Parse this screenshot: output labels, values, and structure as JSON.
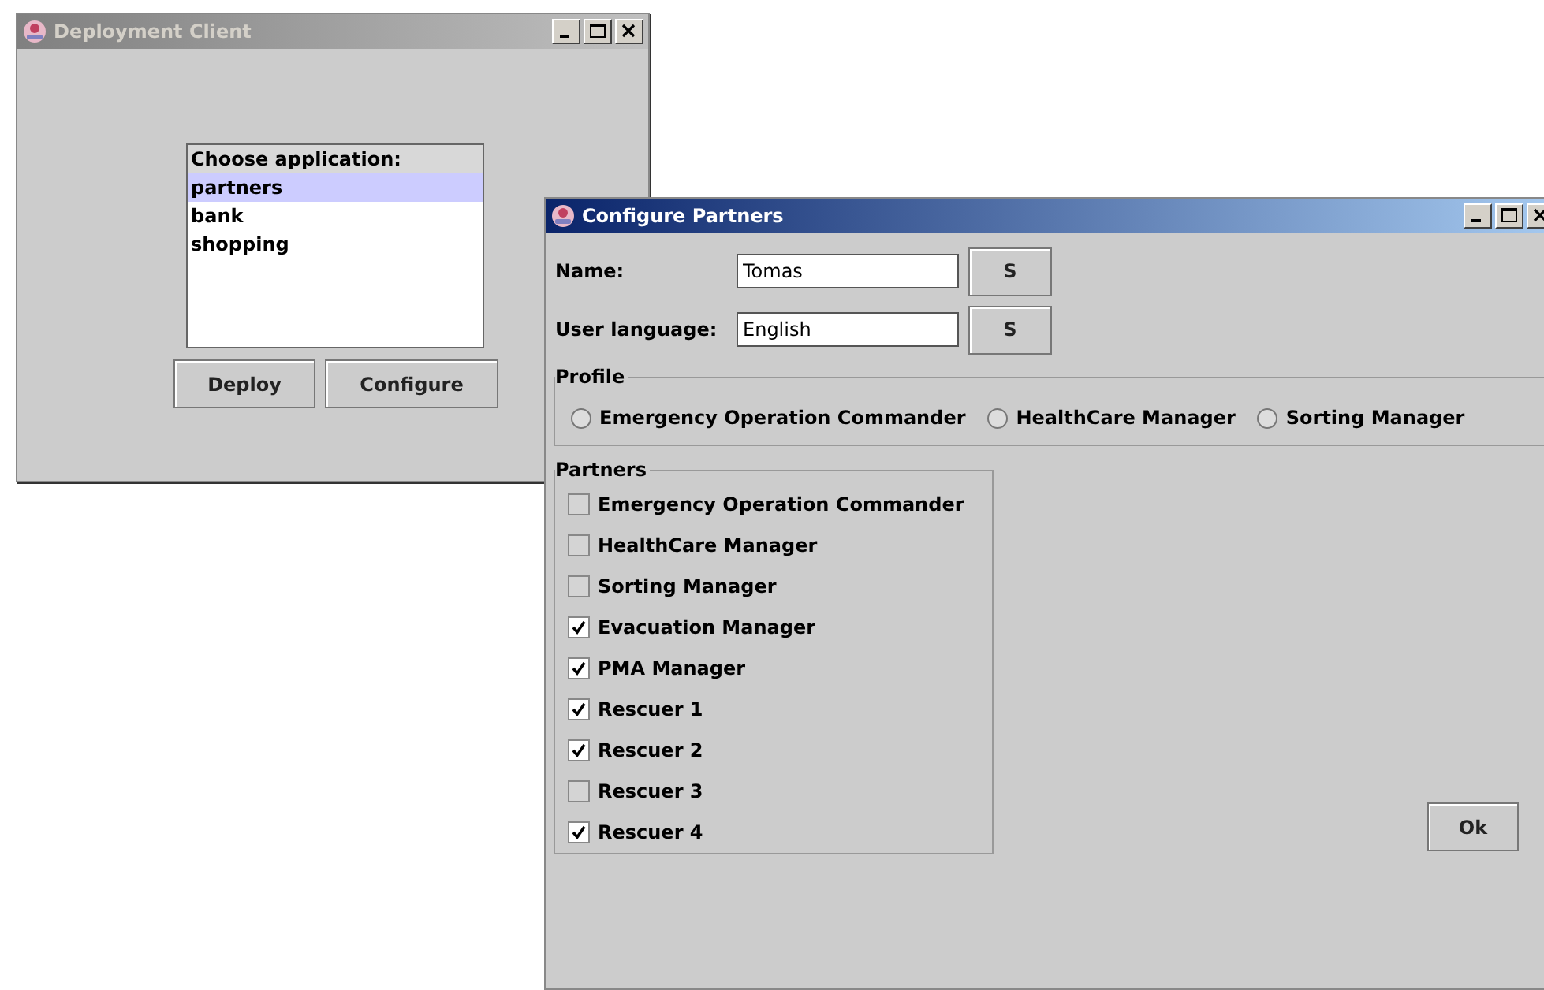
{
  "deployment_window": {
    "title": "Deployment Client",
    "active": false,
    "list": {
      "header": "Choose application:",
      "items": [
        {
          "label": "partners",
          "selected": true
        },
        {
          "label": "bank",
          "selected": false
        },
        {
          "label": "shopping",
          "selected": false
        }
      ]
    },
    "buttons": [
      "Deploy",
      "Configure"
    ]
  },
  "configure_window": {
    "title": "Configure Partners",
    "active": true,
    "fields": [
      {
        "label": "Name:",
        "value": "Tomas",
        "button": "S"
      },
      {
        "label": "User language:",
        "value": "English",
        "button": "S"
      }
    ],
    "profile": {
      "title": "Profile",
      "options": [
        {
          "label": "Emergency Operation Commander",
          "selected": false
        },
        {
          "label": "HealthCare Manager",
          "selected": false
        },
        {
          "label": "Sorting Manager",
          "selected": false
        }
      ]
    },
    "partners": {
      "title": "Partners",
      "items": [
        {
          "label": "Emergency Operation Commander",
          "checked": false
        },
        {
          "label": "HealthCare Manager",
          "checked": false
        },
        {
          "label": "Sorting Manager",
          "checked": false
        },
        {
          "label": "Evacuation Manager",
          "checked": true
        },
        {
          "label": "PMA Manager",
          "checked": true
        },
        {
          "label": "Rescuer 1",
          "checked": true
        },
        {
          "label": "Rescuer 2",
          "checked": true
        },
        {
          "label": "Rescuer 3",
          "checked": false
        },
        {
          "label": "Rescuer 4",
          "checked": true
        }
      ]
    },
    "ok_button": "Ok"
  }
}
